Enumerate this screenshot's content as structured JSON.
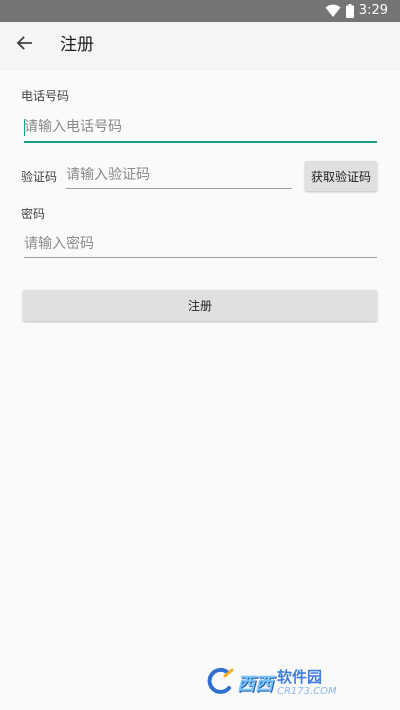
{
  "status_bar": {
    "time": "3:29",
    "icons": [
      "wifi-icon",
      "battery-icon"
    ]
  },
  "app_bar": {
    "title": "注册",
    "back_icon": "arrow-left-icon"
  },
  "form": {
    "phone": {
      "label": "电话号码",
      "value": "",
      "placeholder": "请输入电话号码"
    },
    "code": {
      "label": "验证码",
      "value": "",
      "placeholder": "请输入验证码",
      "button_label": "获取验证码"
    },
    "password": {
      "label": "密码",
      "value": "",
      "placeholder": "请输入密码"
    },
    "submit_label": "注册"
  },
  "watermark": {
    "brand": "西西",
    "name": "软件园",
    "url": "CR173.COM"
  },
  "colors": {
    "status_bar": "#757575",
    "app_bar": "#f5f5f5",
    "background": "#fafafa",
    "accent": "#1a9e8e",
    "button": "#e0e0e0"
  }
}
